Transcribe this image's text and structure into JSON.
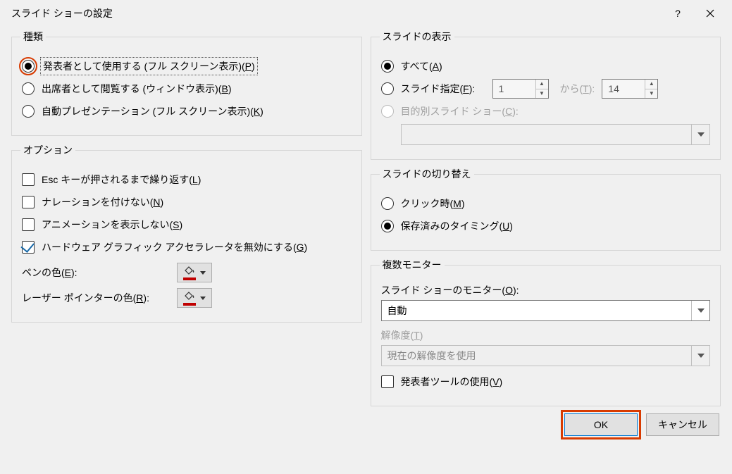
{
  "title": "スライド ショーの設定",
  "help_char": "?",
  "groups": {
    "type": {
      "legend": "種類",
      "opts": {
        "presenter_pre": "発表者として使用する (フル スクリーン表示)(",
        "presenter_key": "P",
        "presenter_post": ")",
        "browsed_pre": "出席者として閲覧する (ウィンドウ表示)(",
        "browsed_key": "B",
        "browsed_post": ")",
        "kiosk_pre": "自動プレゼンテーション (フル スクリーン表示)(",
        "kiosk_key": "K",
        "kiosk_post": ")"
      }
    },
    "options": {
      "legend": "オプション",
      "loop_pre": "Esc キーが押されるまで繰り返す(",
      "loop_key": "L",
      "loop_post": ")",
      "narr_pre": "ナレーションを付けない(",
      "narr_key": "N",
      "narr_post": ")",
      "anim_pre": "アニメーションを表示しない(",
      "anim_key": "S",
      "anim_post": ")",
      "hw_pre": "ハードウェア グラフィック アクセラレータを無効にする(",
      "hw_key": "G",
      "hw_post": ")",
      "pen_pre": "ペンの色(",
      "pen_key": "E",
      "pen_post": "):",
      "laser_pre": "レーザー ポインターの色(",
      "laser_key": "R",
      "laser_post": "):"
    },
    "show_slides": {
      "legend": "スライドの表示",
      "all_pre": "すべて(",
      "all_key": "A",
      "all_post": ")",
      "range_pre": "スライド指定(",
      "range_key": "F",
      "range_post": "):",
      "from_val": "1",
      "to_label_pre": "から(",
      "to_label_key": "T",
      "to_label_post": "):",
      "to_val": "14",
      "custom_pre": "目的別スライド ショー(",
      "custom_key": "C",
      "custom_post": "):"
    },
    "advance": {
      "legend": "スライドの切り替え",
      "manual_pre": "クリック時(",
      "manual_key": "M",
      "manual_post": ")",
      "timing_pre": "保存済みのタイミング(",
      "timing_key": "U",
      "timing_post": ")"
    },
    "monitors": {
      "legend": "複数モニター",
      "mon_pre": "スライド ショーのモニター(",
      "mon_key": "O",
      "mon_post": "):",
      "mon_val": "自動",
      "res_pre": "解像度(",
      "res_key": "T",
      "res_post": ")",
      "res_val": "現在の解像度を使用",
      "presenter_view_pre": "発表者ツールの使用(",
      "presenter_view_key": "V",
      "presenter_view_post": ")"
    }
  },
  "buttons": {
    "ok": "OK",
    "cancel": "キャンセル"
  }
}
